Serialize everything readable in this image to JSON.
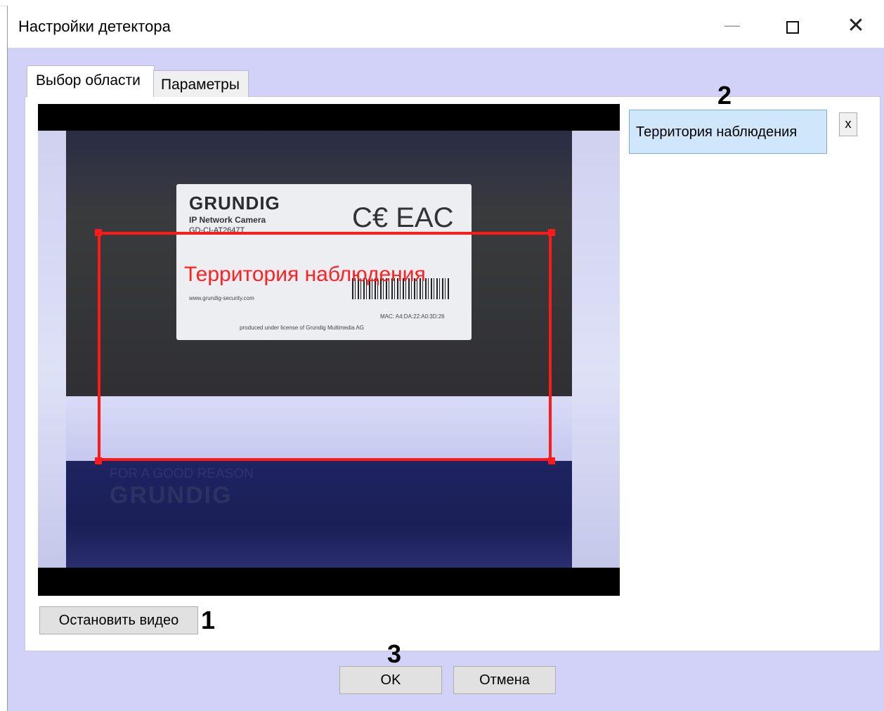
{
  "window": {
    "title": "Настройки детектора",
    "minimize_glyph": "—",
    "close_glyph": "✕"
  },
  "tabs": [
    {
      "label": "Выбор области",
      "active": true
    },
    {
      "label": "Параметры",
      "active": false
    }
  ],
  "video": {
    "label_brand": "GRUNDIG",
    "label_model": "IP Network Camera",
    "label_gd": "GD-CI-AT2647T",
    "label_marks": "C€ EAC",
    "label_mac": "MAC: A4:DA:22:A0:3D:26",
    "label_produced": "produced under license of Grundig Multimedia AG",
    "label_web": "www.grundig-security.com",
    "slogan": "FOR A GOOD REASON",
    "slogan_brand": "GRUNDIG",
    "zone_label": "Территория наблюдения",
    "zone_color": "#ff1a1a"
  },
  "zones": {
    "items": [
      {
        "label": "Территория наблюдения",
        "selected": true
      }
    ],
    "delete_label": "x"
  },
  "buttons": {
    "stop_video": "Остановить видео",
    "ok": "OK",
    "cancel": "Отмена"
  },
  "callouts": {
    "one": "1",
    "two": "2",
    "three": "3"
  }
}
